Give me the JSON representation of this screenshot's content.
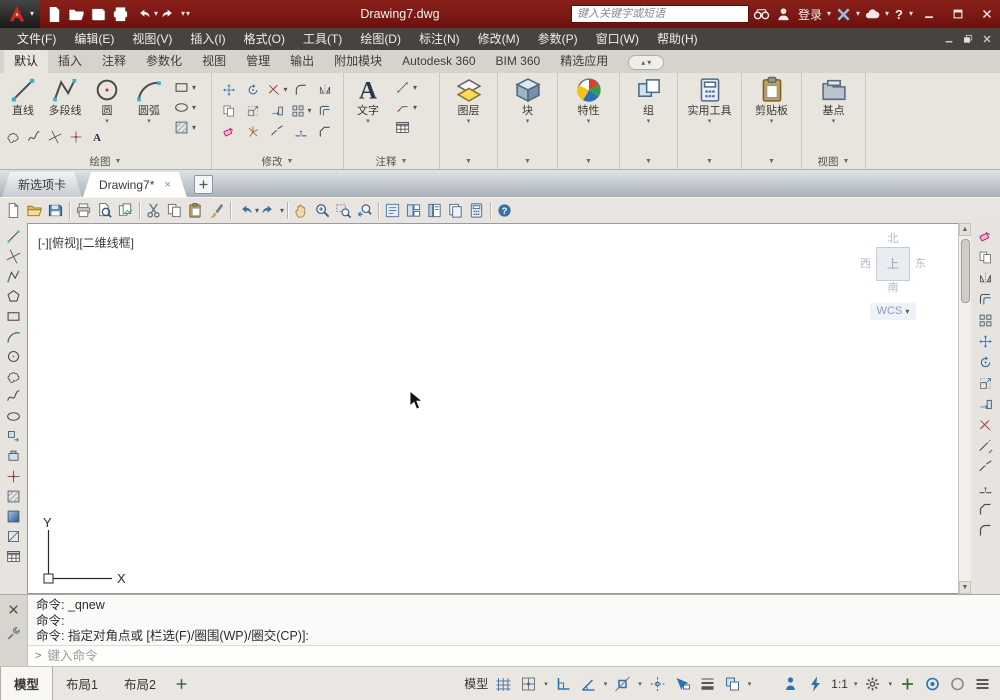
{
  "colors": {
    "titlebar": "#7a1410",
    "accent_blue": "#2a72b8",
    "ribbon_bg": "#e8e5df",
    "canvas_bg": "#ffffff"
  },
  "icons": {
    "dropdown": "▾",
    "panel_expand": "▼",
    "collapse": "▴",
    "help": "?",
    "close": "×",
    "prompt": ">",
    "scroll_up": "▲",
    "scroll_down": "▼"
  },
  "title_bar": {
    "title": "Drawing7.dwg",
    "search_placeholder": "键入关键字或短语",
    "login_label": "登录"
  },
  "menu_bar": {
    "items": [
      "文件(F)",
      "编辑(E)",
      "视图(V)",
      "插入(I)",
      "格式(O)",
      "工具(T)",
      "绘图(D)",
      "标注(N)",
      "修改(M)",
      "参数(P)",
      "窗口(W)",
      "帮助(H)"
    ]
  },
  "ribbon": {
    "tabs": [
      "默认",
      "插入",
      "注释",
      "参数化",
      "视图",
      "管理",
      "输出",
      "附加模块",
      "Autodesk 360",
      "BIM 360",
      "精选应用"
    ],
    "panels": {
      "draw": {
        "label": "绘图",
        "tools": [
          "直线",
          "多段线",
          "圆",
          "圆弧"
        ]
      },
      "modify": {
        "label": "修改"
      },
      "annotate": {
        "label": "注释",
        "text_tool": "文字"
      },
      "layers": {
        "tool": "图层"
      },
      "block": {
        "tool": "块"
      },
      "properties": {
        "tool": "特性"
      },
      "group": {
        "tool": "组"
      },
      "utilities": {
        "tool": "实用工具"
      },
      "clipboard": {
        "tool": "剪贴板"
      },
      "view": {
        "label": "视图",
        "tool": "基点"
      }
    }
  },
  "file_tabs": {
    "new_tab": "新选项卡",
    "active_tab": "Drawing7*"
  },
  "drawing_area": {
    "viewport_controls": "[-][俯视][二维线框]",
    "viewcube": {
      "north": "北",
      "south": "南",
      "east": "东",
      "west": "西",
      "top": "上"
    },
    "wcs_label": "WCS",
    "ucs": {
      "x": "X",
      "y": "Y"
    }
  },
  "command_line": {
    "history": [
      "命令: _qnew",
      "命令:",
      "命令: 指定对角点或 [栏选(F)/圈围(WP)/圈交(CP)]:"
    ],
    "input_placeholder": "键入命令"
  },
  "status_bar": {
    "layout_tabs": [
      "模型",
      "布局1",
      "布局2"
    ],
    "model_label": "模型",
    "annotation_scale": "1:1"
  }
}
